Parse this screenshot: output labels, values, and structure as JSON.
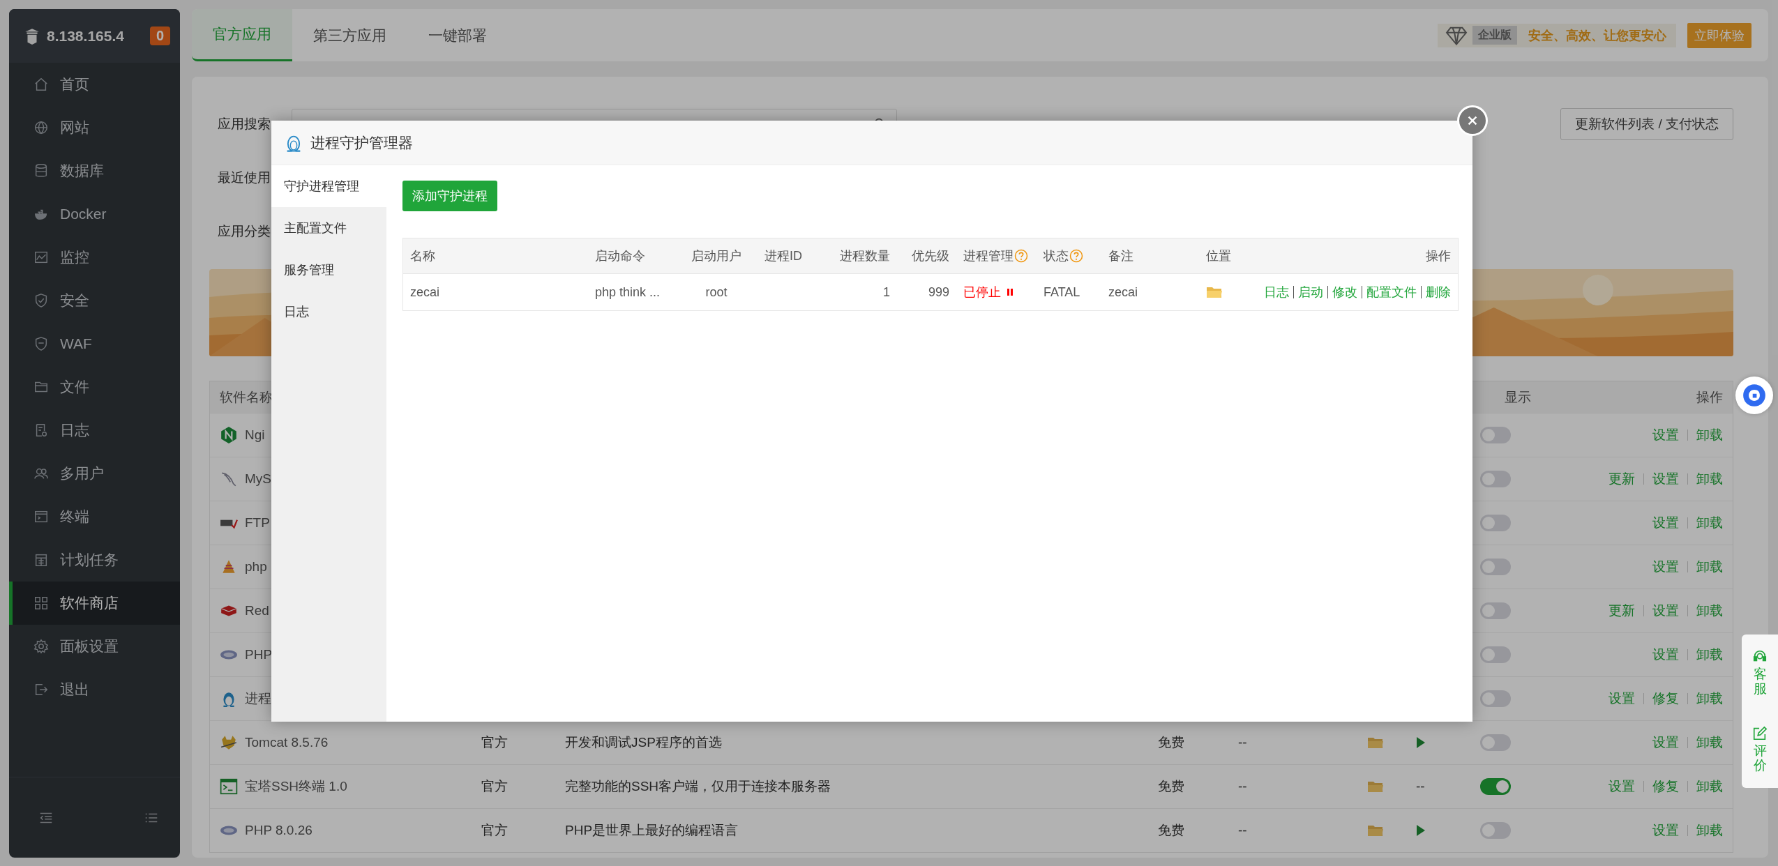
{
  "sidebar": {
    "host": "8.138.165.4",
    "alert_count": "0",
    "items": [
      {
        "label": "首页",
        "selected": false
      },
      {
        "label": "网站",
        "selected": false
      },
      {
        "label": "数据库",
        "selected": false
      },
      {
        "label": "Docker",
        "selected": false
      },
      {
        "label": "监控",
        "selected": false
      },
      {
        "label": "安全",
        "selected": false
      },
      {
        "label": "WAF",
        "selected": false
      },
      {
        "label": "文件",
        "selected": false
      },
      {
        "label": "日志",
        "selected": false
      },
      {
        "label": "多用户",
        "selected": false
      },
      {
        "label": "终端",
        "selected": false
      },
      {
        "label": "计划任务",
        "selected": false
      },
      {
        "label": "软件商店",
        "selected": true
      },
      {
        "label": "面板设置",
        "selected": false
      },
      {
        "label": "退出",
        "selected": false
      }
    ]
  },
  "top_tabs": [
    {
      "label": "官方应用",
      "selected": true
    },
    {
      "label": "第三方应用",
      "selected": false
    },
    {
      "label": "一键部署",
      "selected": false
    }
  ],
  "promo": {
    "edition": "企业版",
    "slogan": "安全、高效、让您更安心",
    "button": "立即体验"
  },
  "store": {
    "search_label": "应用搜索",
    "recent_label": "最近使用",
    "category_label": "应用分类",
    "refresh_button": "更新软件列表 / 支付状态"
  },
  "software_table": {
    "columns": {
      "name": "软件名称",
      "home_display": "显示",
      "actions": "操作"
    },
    "rows": [
      {
        "kind": "covered",
        "name": "Ngi",
        "home_display": false,
        "actions": [
          "设置",
          "卸载"
        ]
      },
      {
        "kind": "covered",
        "name": "MyS",
        "home_display": false,
        "actions": [
          "更新",
          "设置",
          "卸载"
        ]
      },
      {
        "kind": "covered",
        "name": "FTP",
        "home_display": false,
        "actions": [
          "设置",
          "卸载"
        ]
      },
      {
        "kind": "covered",
        "name": "php",
        "home_display": false,
        "actions": [
          "设置",
          "卸载"
        ]
      },
      {
        "kind": "covered",
        "name": "Red",
        "home_display": false,
        "actions": [
          "更新",
          "设置",
          "卸载"
        ]
      },
      {
        "kind": "covered",
        "name": "PHP",
        "home_display": false,
        "actions": [
          "设置",
          "卸载"
        ]
      },
      {
        "kind": "covered",
        "name": "进程",
        "home_display": false,
        "actions": [
          "设置",
          "修复",
          "卸载"
        ]
      },
      {
        "kind": "full",
        "name": "Tomcat 8.5.76",
        "developer": "官方",
        "description": "开发和调试JSP程序的首选",
        "price": "免费",
        "expiry": "--",
        "status": {
          "kind": "start"
        },
        "home_display": false,
        "actions": [
          "设置",
          "卸载"
        ]
      },
      {
        "kind": "full",
        "name": "宝塔SSH终端 1.0",
        "developer": "官方",
        "description": "完整功能的SSH客户端，仅用于连接本服务器",
        "price": "免费",
        "expiry": "--",
        "status": {
          "kind": "text",
          "text": "--"
        },
        "home_display": true,
        "actions": [
          "设置",
          "修复",
          "卸载"
        ]
      },
      {
        "kind": "full",
        "name": "PHP 8.0.26",
        "developer": "官方",
        "description": "PHP是世界上最好的编程语言",
        "price": "免费",
        "expiry": "--",
        "status": {
          "kind": "start"
        },
        "home_display": false,
        "actions": [
          "设置",
          "卸载"
        ]
      }
    ]
  },
  "modal": {
    "title": "进程守护管理器",
    "nav": [
      {
        "label": "守护进程管理",
        "selected": true
      },
      {
        "label": "主配置文件",
        "selected": false
      },
      {
        "label": "服务管理",
        "selected": false
      },
      {
        "label": "日志",
        "selected": false
      }
    ],
    "add_button": "添加守护进程",
    "columns": [
      {
        "label": "名称",
        "help": false
      },
      {
        "label": "启动命令",
        "help": false
      },
      {
        "label": "启动用户",
        "help": false
      },
      {
        "label": "进程ID",
        "help": false
      },
      {
        "label": "进程数量",
        "help": false
      },
      {
        "label": "优先级",
        "help": false
      },
      {
        "label": "进程管理",
        "help": true
      },
      {
        "label": "状态",
        "help": true
      },
      {
        "label": "备注",
        "help": false
      },
      {
        "label": "位置",
        "help": false
      },
      {
        "label": "操作",
        "help": false
      }
    ],
    "rows": [
      {
        "name": "zecai",
        "command": "php think ...",
        "user": "root",
        "count": "1",
        "priority": "999",
        "manage": "已停止",
        "stopped": true,
        "state": "FATAL",
        "note": "zecai",
        "actions": [
          "日志",
          "启动",
          "修改",
          "配置文件",
          "删除"
        ]
      }
    ]
  },
  "support": [
    {
      "label": "客服"
    },
    {
      "label": "评价"
    }
  ]
}
